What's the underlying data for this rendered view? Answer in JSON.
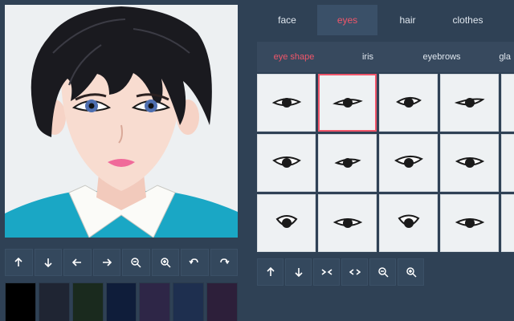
{
  "top_tabs": [
    "face",
    "eyes",
    "hair",
    "clothes"
  ],
  "top_tabs_active": 1,
  "sub_tabs": [
    "eye shape",
    "iris",
    "eyebrows",
    "gla"
  ],
  "sub_tabs_active": 0,
  "selected_cell": 1,
  "left_toolbar": [
    "arrow-up-icon",
    "arrow-down-icon",
    "arrow-left-icon",
    "arrow-right-icon",
    "zoom-out-icon",
    "zoom-in-icon",
    "undo-icon",
    "redo-icon"
  ],
  "right_toolbar": [
    "arrow-up-icon",
    "arrow-down-icon",
    "narrow-icon",
    "widen-icon",
    "zoom-out-icon",
    "zoom-in-icon"
  ],
  "palette_colors": [
    "#000000",
    "#1f2533",
    "#1a2a1e",
    "#0f1d3a",
    "#2e2647",
    "#1e2f4f",
    "#2d1f3a"
  ],
  "accent_color": "#f0566a"
}
